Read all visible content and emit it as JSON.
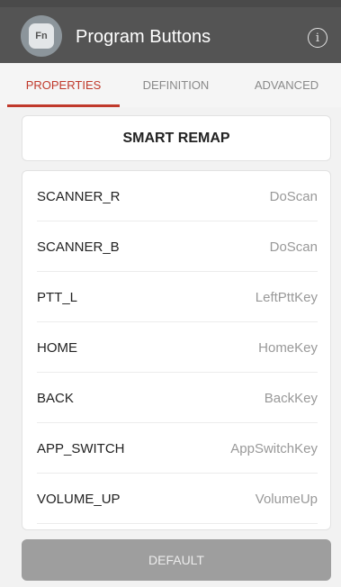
{
  "header": {
    "title": "Program Buttons",
    "logo_text": "Fn",
    "info_glyph": "i"
  },
  "tabs": [
    {
      "label": "PROPERTIES",
      "active": true
    },
    {
      "label": "DEFINITION",
      "active": false
    },
    {
      "label": "ADVANCED",
      "active": false
    }
  ],
  "smart_remap_label": "SMART REMAP",
  "mappings": [
    {
      "key": "SCANNER_R",
      "value": "DoScan"
    },
    {
      "key": "SCANNER_B",
      "value": "DoScan"
    },
    {
      "key": "PTT_L",
      "value": "LeftPttKey"
    },
    {
      "key": "HOME",
      "value": "HomeKey"
    },
    {
      "key": "BACK",
      "value": "BackKey"
    },
    {
      "key": "APP_SWITCH",
      "value": "AppSwitchKey"
    },
    {
      "key": "VOLUME_UP",
      "value": "VolumeUp"
    }
  ],
  "default_label": "DEFAULT",
  "colors": {
    "app_bar": "#545454",
    "accent": "#c0392b",
    "default_button": "#9e9e9e"
  }
}
